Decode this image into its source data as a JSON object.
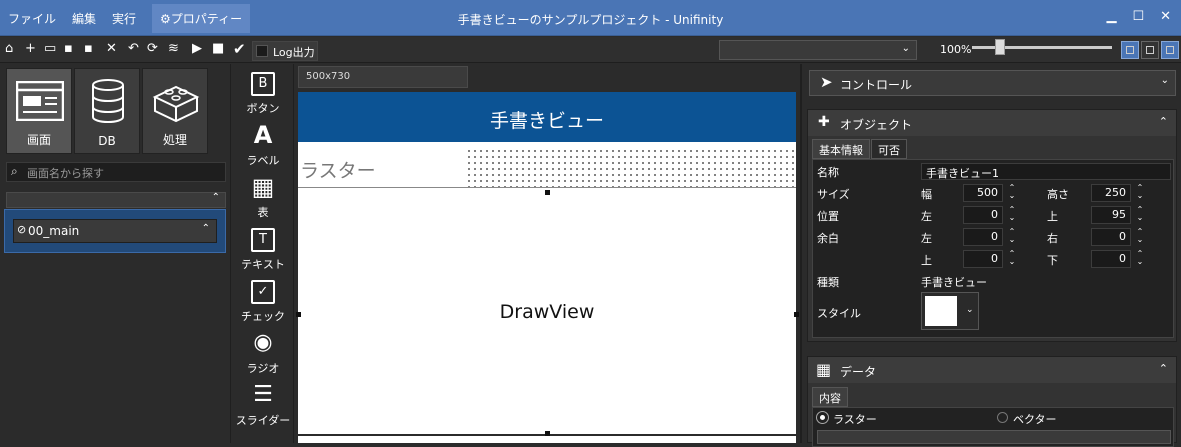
{
  "menu": {
    "file": "ファイル",
    "edit": "編集",
    "run": "実行",
    "properties": "⚙プロパティー"
  },
  "window": {
    "title": "手書きビューのサンプルプロジェクト - Unifinity"
  },
  "toolbar": {
    "log_label": "Log出力",
    "zoom": "100%",
    "zoom_fraction": 0.2
  },
  "left": {
    "categories": [
      {
        "label": "画面",
        "icon": "screen-icon"
      },
      {
        "label": "DB",
        "icon": "database-icon"
      },
      {
        "label": "処理",
        "icon": "blocks-icon"
      }
    ],
    "search_placeholder": "画面名から探す",
    "selected_screen": "00_main"
  },
  "palette": [
    {
      "label": "ボタン",
      "icon": "button-icon",
      "glyph": "B"
    },
    {
      "label": "ラベル",
      "icon": "label-icon",
      "glyph": "A"
    },
    {
      "label": "表",
      "icon": "table-icon",
      "glyph": "▦"
    },
    {
      "label": "テキスト",
      "icon": "text-icon",
      "glyph": "T"
    },
    {
      "label": "チェック",
      "icon": "check-icon",
      "glyph": "✓"
    },
    {
      "label": "ラジオ",
      "icon": "radio-icon",
      "glyph": "◉"
    },
    {
      "label": "スライダー",
      "icon": "slider-icon",
      "glyph": "☰"
    }
  ],
  "canvas": {
    "size_tab": "500x730",
    "header_title": "手書きビュー",
    "raster_label": "ラスター",
    "draw_label": "DrawView"
  },
  "right": {
    "control_select": "コントロール",
    "object": {
      "header": "オブジェクト",
      "tabs": [
        "基本情報",
        "可否"
      ],
      "name_label": "名称",
      "name_value": "手書きビュー1",
      "size_label": "サイズ",
      "width_label": "幅",
      "width_value": "500",
      "height_label": "高さ",
      "height_value": "250",
      "position_label": "位置",
      "left_label": "左",
      "left_value": "0",
      "top_label": "上",
      "top_value": "95",
      "margin_label": "余白",
      "margin_left_label": "左",
      "margin_left_value": "0",
      "margin_right_label": "右",
      "margin_right_value": "0",
      "margin_top_label": "上",
      "margin_top_value": "0",
      "margin_bottom_label": "下",
      "margin_bottom_value": "0",
      "kind_label": "種類",
      "kind_value": "手書きビュー",
      "style_label": "スタイル"
    },
    "data": {
      "header": "データ",
      "tab": "内容",
      "raster": "ラスター",
      "vector": "ベクター"
    }
  }
}
